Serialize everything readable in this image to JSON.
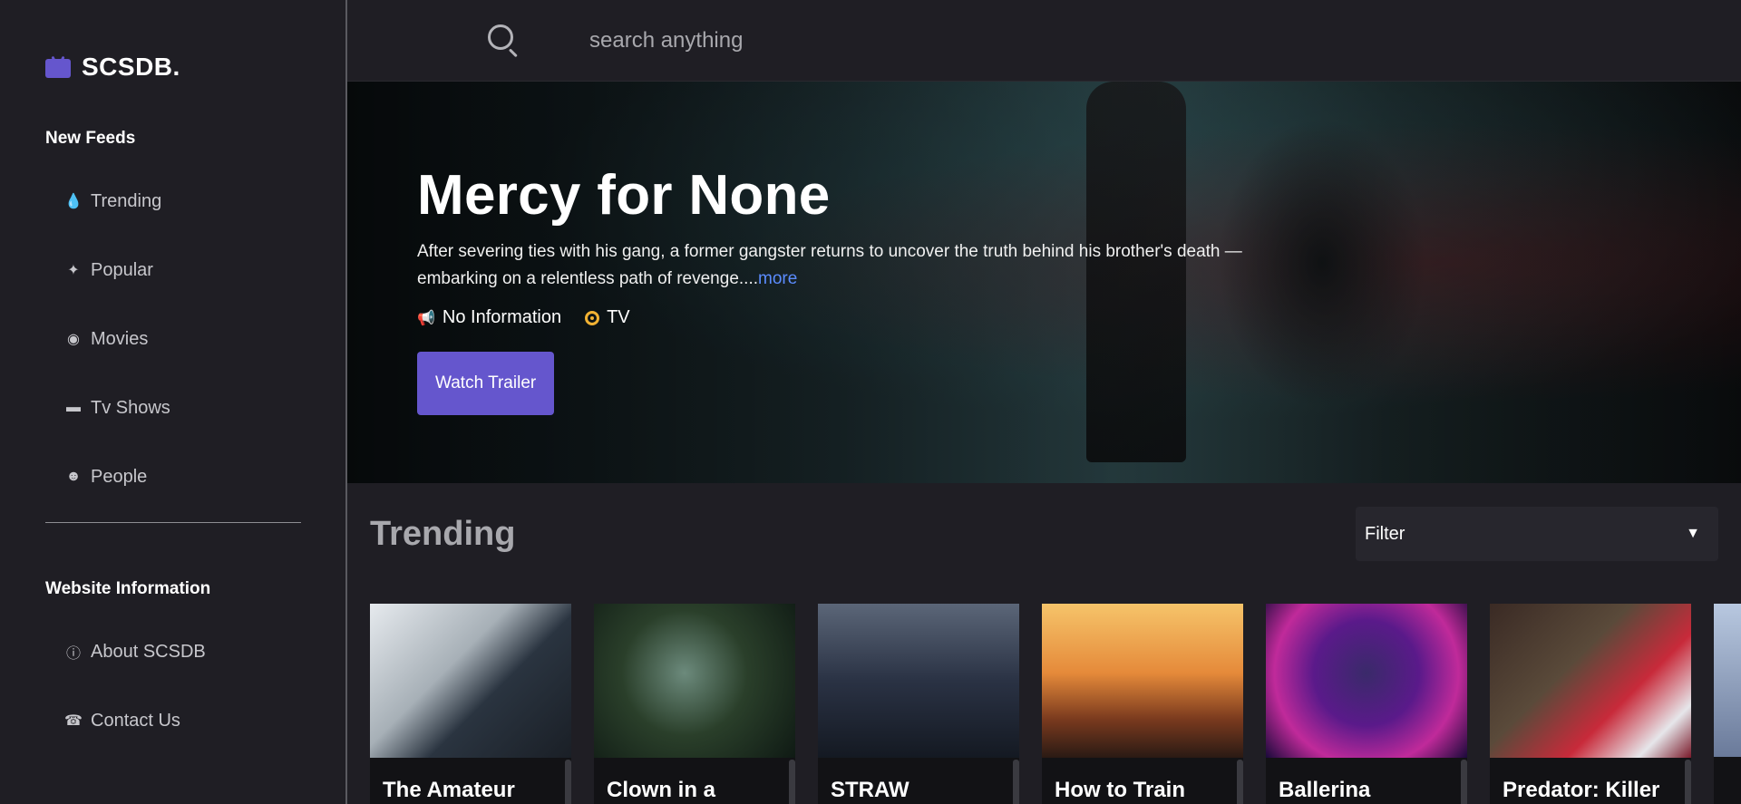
{
  "brand": {
    "name": "SCSDB.",
    "accent": "#6556cd"
  },
  "sidebar": {
    "feeds_title": "New Feeds",
    "items": [
      {
        "label": "Trending",
        "icon": "fire-icon"
      },
      {
        "label": "Popular",
        "icon": "sparkle-icon"
      },
      {
        "label": "Movies",
        "icon": "film-reel-icon"
      },
      {
        "label": "Tv Shows",
        "icon": "tv-icon"
      },
      {
        "label": "People",
        "icon": "people-icon"
      }
    ],
    "info_title": "Website Information",
    "info_items": [
      {
        "label": "About SCSDB",
        "icon": "info-icon"
      },
      {
        "label": "Contact Us",
        "icon": "phone-icon"
      }
    ]
  },
  "search": {
    "placeholder": "search anything"
  },
  "hero": {
    "title": "Mercy for None",
    "description": "After severing ties with his gang, a former gangster returns to uncover the truth behind his brother's death — embarking on a relentless path of revenge....",
    "more_label": "more",
    "release": "No Information",
    "media_type": "TV",
    "button_label": "Watch Trailer"
  },
  "trending": {
    "title": "Trending",
    "filter_label": "Filter",
    "cards": [
      {
        "title": "The Amateur"
      },
      {
        "title": "Clown in a"
      },
      {
        "title": "STRAW"
      },
      {
        "title": "How to Train"
      },
      {
        "title": "Ballerina"
      },
      {
        "title": "Predator: Killer"
      }
    ]
  }
}
